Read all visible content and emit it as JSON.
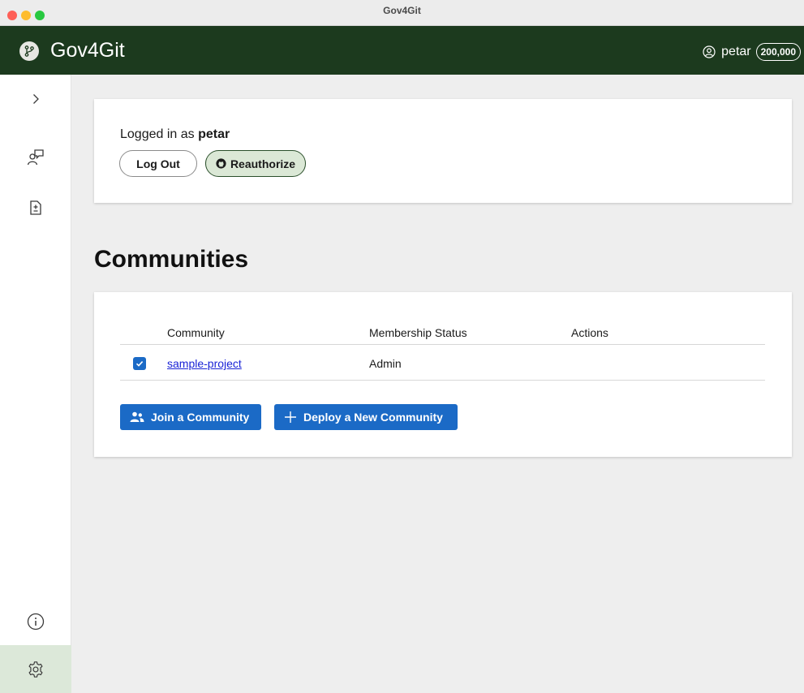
{
  "window": {
    "title": "Gov4Git"
  },
  "header": {
    "app_name": "Gov4Git",
    "username": "petar",
    "balance": "200,000",
    "colors": {
      "background": "#1c3a1e",
      "text": "#ffffff"
    }
  },
  "sidebar": {
    "items": [
      {
        "icon": "chevron-right-icon"
      },
      {
        "icon": "user-feedback-icon"
      },
      {
        "icon": "document-diff-icon"
      },
      {
        "icon": "info-icon"
      },
      {
        "icon": "gear-icon",
        "active": true
      }
    ]
  },
  "login": {
    "prefix": "Logged in as",
    "username": "petar",
    "logout_label": "Log Out",
    "reauthorize_label": "Reauthorize"
  },
  "communities": {
    "title": "Communities",
    "columns": [
      "Community",
      "Membership Status",
      "Actions"
    ],
    "rows": [
      {
        "checked": true,
        "name": "sample-project",
        "status": "Admin",
        "actions": ""
      }
    ],
    "join_label": "Join a Community",
    "deploy_label": "Deploy a New Community",
    "accent": "#1b6ac6"
  }
}
